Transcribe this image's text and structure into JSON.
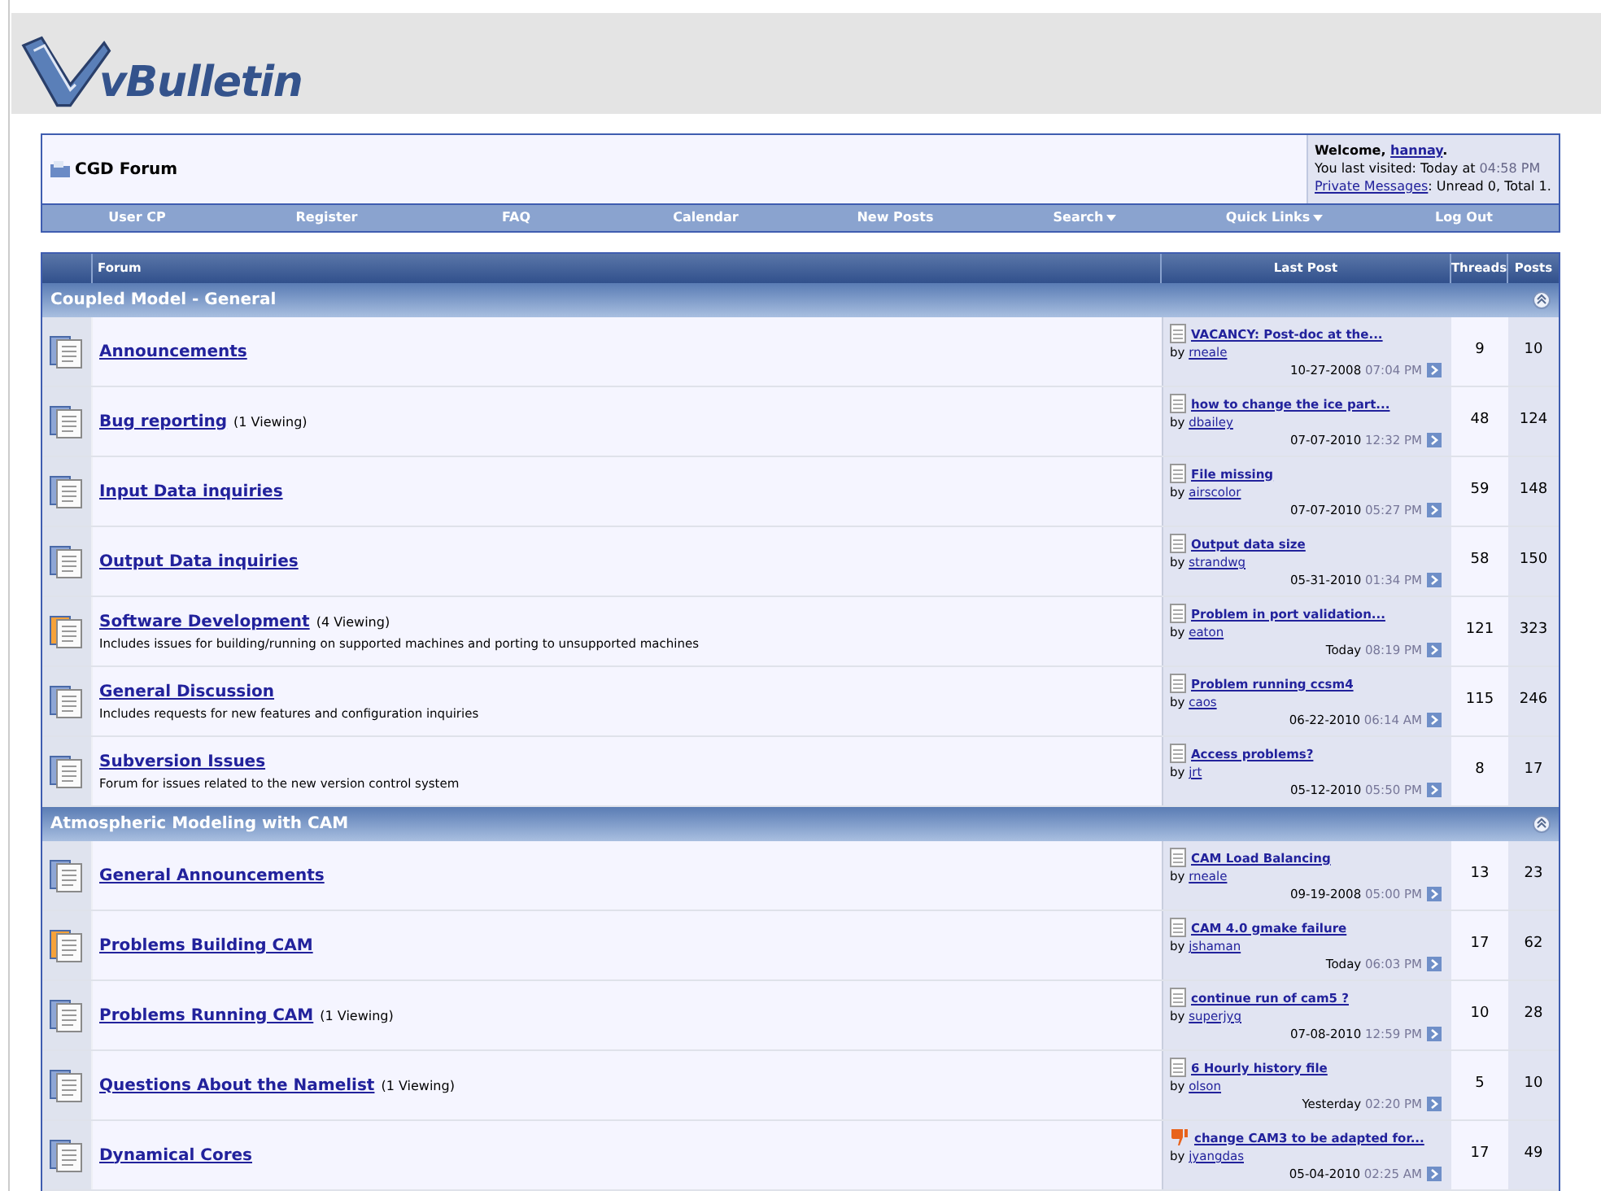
{
  "logo": {
    "text": "vBulletin"
  },
  "navbar": {
    "title": "CGD Forum",
    "welcome": {
      "prefix": "Welcome,",
      "user": "hannay",
      "suffix": "."
    },
    "last_visit": {
      "label": "You last visited: Today at",
      "time": "04:58 PM"
    },
    "messages": {
      "link": "Private Messages",
      "text": ": Unread 0, Total 1."
    },
    "links": [
      {
        "label": "User CP",
        "menu": false
      },
      {
        "label": "Register",
        "menu": false
      },
      {
        "label": "FAQ",
        "menu": false
      },
      {
        "label": "Calendar",
        "menu": false
      },
      {
        "label": "New Posts",
        "menu": false
      },
      {
        "label": "Search",
        "menu": true
      },
      {
        "label": "Quick Links",
        "menu": true
      },
      {
        "label": "Log Out",
        "menu": false
      }
    ]
  },
  "table": {
    "columns": [
      "Forum",
      "Last Post",
      "Threads",
      "Posts"
    ],
    "categories": [
      {
        "title": "Coupled Model - General",
        "forums": [
          {
            "name": "Announcements",
            "new_posts": false,
            "last_post": {
              "kind": "document",
              "title": "VACANCY: Post-doc at the...",
              "by": "by",
              "user": "rneale",
              "date": "10-27-2008",
              "time": "07:04 PM"
            },
            "threads": "9",
            "posts": "10"
          },
          {
            "name": "Bug reporting",
            "viewing": "(1 Viewing)",
            "new_posts": false,
            "last_post": {
              "kind": "document",
              "title": "how to change the ice part...",
              "by": "by",
              "user": "dbailey",
              "date": "07-07-2010",
              "time": "12:32 PM"
            },
            "threads": "48",
            "posts": "124"
          },
          {
            "name": "Input Data inquiries",
            "new_posts": false,
            "last_post": {
              "kind": "document",
              "title": "File missing",
              "by": "by",
              "user": "airscolor",
              "date": "07-07-2010",
              "time": "05:27 PM"
            },
            "threads": "59",
            "posts": "148"
          },
          {
            "name": "Output Data inquiries",
            "new_posts": false,
            "last_post": {
              "kind": "document",
              "title": "Output data size",
              "by": "by",
              "user": "strandwg",
              "date": "05-31-2010",
              "time": "01:34 PM"
            },
            "threads": "58",
            "posts": "150"
          },
          {
            "name": "Software Development",
            "viewing": "(4 Viewing)",
            "description": "Includes issues for building/running on supported machines and porting to unsupported machines",
            "new_posts": true,
            "last_post": {
              "kind": "document",
              "title": "Problem in port validation...",
              "by": "by",
              "user": "eaton",
              "date": "Today",
              "time": "08:19 PM"
            },
            "threads": "121",
            "posts": "323"
          },
          {
            "name": "General Discussion",
            "description": "Includes requests for new features and configuration inquiries",
            "new_posts": false,
            "last_post": {
              "kind": "document",
              "title": "Problem running ccsm4",
              "by": "by",
              "user": "caos",
              "date": "06-22-2010",
              "time": "06:14 AM"
            },
            "threads": "115",
            "posts": "246"
          },
          {
            "name": "Subversion Issues",
            "description": "Forum for issues related to the new version control system",
            "new_posts": false,
            "last_post": {
              "kind": "document",
              "title": "Access problems?",
              "by": "by",
              "user": "jrt",
              "date": "05-12-2010",
              "time": "05:50 PM"
            },
            "threads": "8",
            "posts": "17"
          }
        ]
      },
      {
        "title": "Atmospheric Modeling with CAM",
        "forums": [
          {
            "name": "General Announcements",
            "new_posts": false,
            "last_post": {
              "kind": "document",
              "title": "CAM Load Balancing",
              "by": "by",
              "user": "rneale",
              "date": "09-19-2008",
              "time": "05:00 PM"
            },
            "threads": "13",
            "posts": "23"
          },
          {
            "name": "Problems Building CAM",
            "new_posts": true,
            "last_post": {
              "kind": "document",
              "title": "CAM 4.0 gmake failure",
              "by": "by",
              "user": "jshaman",
              "date": "Today",
              "time": "06:03 PM"
            },
            "threads": "17",
            "posts": "62"
          },
          {
            "name": "Problems Running CAM",
            "viewing": "(1 Viewing)",
            "new_posts": false,
            "last_post": {
              "kind": "document",
              "title": "continue run of cam5 ?",
              "by": "by",
              "user": "superjyg",
              "date": "07-08-2010",
              "time": "12:59 PM"
            },
            "threads": "10",
            "posts": "28"
          },
          {
            "name": "Questions About the Namelist",
            "viewing": "(1 Viewing)",
            "new_posts": false,
            "last_post": {
              "kind": "document",
              "title": "6 Hourly history file",
              "by": "by",
              "user": "olson",
              "date": "Yesterday",
              "time": "02:20 PM"
            },
            "threads": "5",
            "posts": "10"
          },
          {
            "name": "Dynamical Cores",
            "new_posts": false,
            "last_post": {
              "kind": "thumbs_down",
              "title": "change CAM3 to be adapted for...",
              "by": "by",
              "user": "jyangdas",
              "date": "05-04-2010",
              "time": "02:25 AM"
            },
            "threads": "17",
            "posts": "49"
          }
        ]
      }
    ]
  }
}
